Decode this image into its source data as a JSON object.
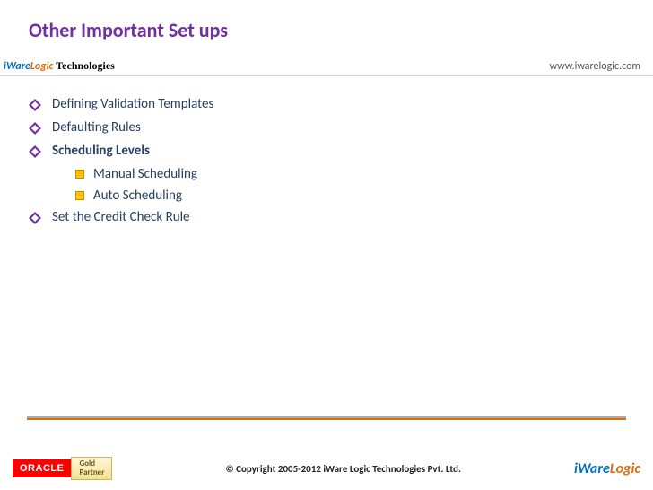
{
  "title": "Other Important Set ups",
  "header": {
    "brand_iware": "iWare",
    "brand_logic": "Logic",
    "brand_tech": " Technologies",
    "url": "www.iwarelogic.com"
  },
  "items": [
    {
      "text": "Defining Validation Templates",
      "level": 1,
      "bold": false
    },
    {
      "text": "Defaulting Rules",
      "level": 1,
      "bold": false
    },
    {
      "text": "Scheduling Levels",
      "level": 1,
      "bold": true
    },
    {
      "text": "Manual Scheduling",
      "level": 2,
      "bold": false
    },
    {
      "text": "Auto Scheduling",
      "level": 2,
      "bold": false
    },
    {
      "text": "Set the Credit Check Rule",
      "level": 1,
      "bold": false
    }
  ],
  "footer": {
    "oracle": "ORACLE",
    "gold_line1": "Gold",
    "gold_line2": "Partner",
    "copyright": "© Copyright 2005-2012 iWare Logic Technologies Pvt. Ltd.",
    "brand_iware": "iWare",
    "brand_logic": "Logic"
  }
}
